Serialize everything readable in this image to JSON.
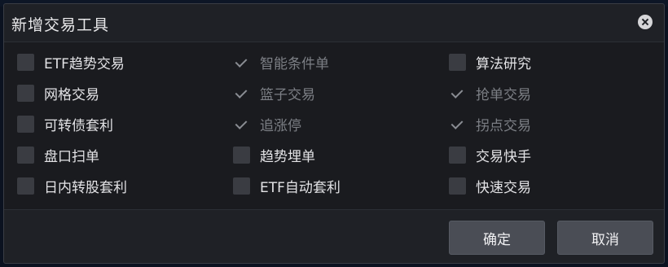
{
  "dialog": {
    "title": "新增交易工具",
    "close_icon": "close-icon",
    "options": [
      {
        "label": "ETF趋势交易",
        "state": "unchecked"
      },
      {
        "label": "智能条件单",
        "state": "checked-disabled"
      },
      {
        "label": "算法研究",
        "state": "unchecked"
      },
      {
        "label": "网格交易",
        "state": "unchecked"
      },
      {
        "label": "篮子交易",
        "state": "checked-disabled"
      },
      {
        "label": "抢单交易",
        "state": "checked-disabled"
      },
      {
        "label": "可转债套利",
        "state": "unchecked"
      },
      {
        "label": "追涨停",
        "state": "checked-disabled"
      },
      {
        "label": "拐点交易",
        "state": "checked-disabled"
      },
      {
        "label": "盘口扫单",
        "state": "unchecked"
      },
      {
        "label": "趋势埋单",
        "state": "unchecked"
      },
      {
        "label": "交易快手",
        "state": "unchecked"
      },
      {
        "label": "日内转股套利",
        "state": "unchecked"
      },
      {
        "label": "ETF自动套利",
        "state": "unchecked"
      },
      {
        "label": "快速交易",
        "state": "unchecked"
      }
    ],
    "buttons": {
      "confirm_label": "确定",
      "cancel_label": "取消"
    },
    "colors": {
      "dialog_bg": "#1f2126",
      "body_bg": "#1a1b1f",
      "checkbox_bg": "#3a3c42",
      "button_bg": "#4a4d55",
      "text": "#e3e3e6",
      "disabled_text": "#7c7f85"
    }
  }
}
